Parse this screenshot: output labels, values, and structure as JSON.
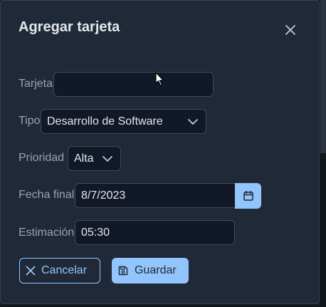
{
  "dialog": {
    "title": "Agregar tarjeta",
    "close_icon": "close-icon"
  },
  "form": {
    "tarjeta": {
      "label": "Tarjeta",
      "value": ""
    },
    "tipo": {
      "label": "Tipo",
      "value": "Desarrollo de Software"
    },
    "prioridad": {
      "label": "Prioridad",
      "value": "Alta"
    },
    "fecha_final": {
      "label": "Fecha final",
      "value": "8/7/2023"
    },
    "estimacion": {
      "label": "Estimación",
      "value": "05:30"
    }
  },
  "buttons": {
    "cancel_label": "Cancelar",
    "save_label": "Guardar"
  },
  "colors": {
    "accent": "#93c5fd",
    "surface": "#1f2937",
    "input_bg": "#111827"
  }
}
